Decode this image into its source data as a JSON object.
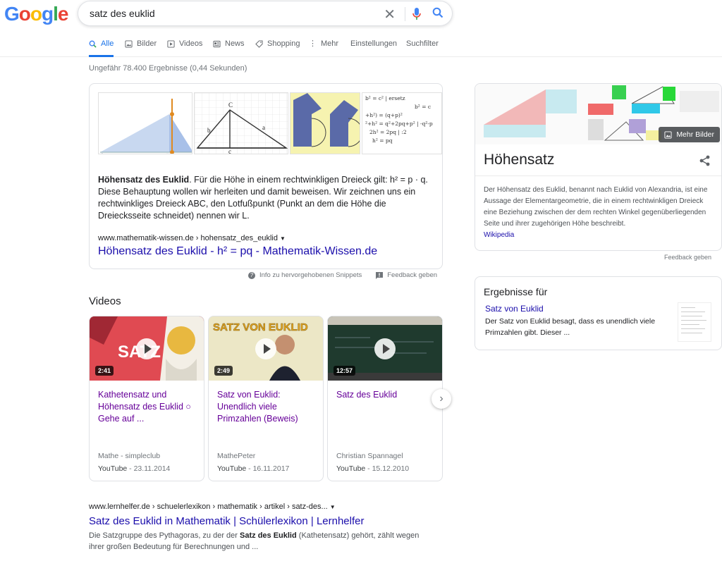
{
  "logo": {
    "letters": [
      "G",
      "o",
      "o",
      "g",
      "l",
      "e"
    ],
    "colors": [
      "#4285F4",
      "#EA4335",
      "#FBBC05",
      "#4285F4",
      "#34A853",
      "#EA4335"
    ]
  },
  "search": {
    "query": "satz des euklid"
  },
  "tabs": [
    {
      "label": "Alle",
      "icon": "search-icon",
      "active": true
    },
    {
      "label": "Bilder",
      "icon": "image-icon"
    },
    {
      "label": "Videos",
      "icon": "video-icon"
    },
    {
      "label": "News",
      "icon": "news-icon"
    },
    {
      "label": "Shopping",
      "icon": "tag-icon"
    },
    {
      "label": "Mehr",
      "icon": "more-vert-icon"
    },
    {
      "label": "Einstellungen"
    },
    {
      "label": "Suchfilter"
    }
  ],
  "stats": "Ungefähr 78.400 Ergebnisse (0,44 Sekunden)",
  "snippet": {
    "bold": "Höhensatz des Euklid",
    "text": ". Für die Höhe in einem rechtwinkligen Dreieck gilt: h² = p · q. Diese Behauptung wollen wir herleiten und damit beweisen. Wir zeichnen uns ein rechtwinkliges Dreieck ABC, den Lotfußpunkt (Punkt an dem die Höhe die Dreiecksseite schneidet) nennen wir L.",
    "url": "www.mathematik-wissen.de › hohensatz_des_euklid",
    "title": "Höhensatz des Euklid - h² = pq - Mathematik-Wissen.de",
    "about": "Info zu hervorgehobenen Snippets",
    "feedback": "Feedback geben",
    "formula": {
      "l1": "b²  =  c²      | ersetz",
      "l2": "b² = c",
      "l3": "+h²) = (q+p)²",
      "l4": "²+h² = q²+2pq+p² | -q²-p",
      "l5": "2h² = 2pq      | :2",
      "l6": "h² = pq"
    }
  },
  "videos": {
    "heading": "Videos",
    "items": [
      {
        "duration": "2:41",
        "title": "Kathetensatz und Höhensatz des Euklid ○ Gehe auf ...",
        "channel": "Mathe - simpleclub",
        "source": "YouTube",
        "date": " - 23.11.2014",
        "thumb_text": "SATZ"
      },
      {
        "duration": "2:49",
        "title": "Satz von Euklid: Unendlich viele Primzahlen (Beweis)",
        "channel": "MathePeter",
        "source": "YouTube",
        "date": " - 16.11.2017",
        "thumb_text": "SATZ VON EUKLID"
      },
      {
        "duration": "12:57",
        "title": "Satz des Euklid",
        "channel": "Christian Spannagel",
        "source": "YouTube",
        "date": " - 15.12.2010"
      }
    ]
  },
  "result": {
    "url": "www.lernhelfer.de › schuelerlexikon › mathematik › artikel › satz-des...",
    "title": "Satz des Euklid in Mathematik | Schülerlexikon | Lernhelfer",
    "desc1": "Die Satzgruppe des Pythagoras, zu der der ",
    "desc_bold": "Satz des Euklid",
    "desc2": " (Kathetensatz) gehört, zählt wegen ihrer großen Bedeutung für Berechnungen und ..."
  },
  "knowledge": {
    "title": "Höhensatz",
    "more_images": "Mehr Bilder",
    "description": "Der Höhensatz des Euklid, benannt nach Euklid von Alexandria, ist eine Aussage der Elementargeometrie, die in einem rechtwinkligen Dreieck eine Beziehung zwischen der dem rechten Winkel gegenüberliegenden Seite und ihrer zugehörigen Höhe beschreibt.",
    "source": "Wikipedia",
    "feedback": "Feedback geben"
  },
  "results_for": {
    "heading": "Ergebnisse für",
    "link": "Satz von Euklid",
    "desc": "Der Satz von Euklid besagt, dass es unendlich viele Primzahlen gibt. Dieser ..."
  }
}
